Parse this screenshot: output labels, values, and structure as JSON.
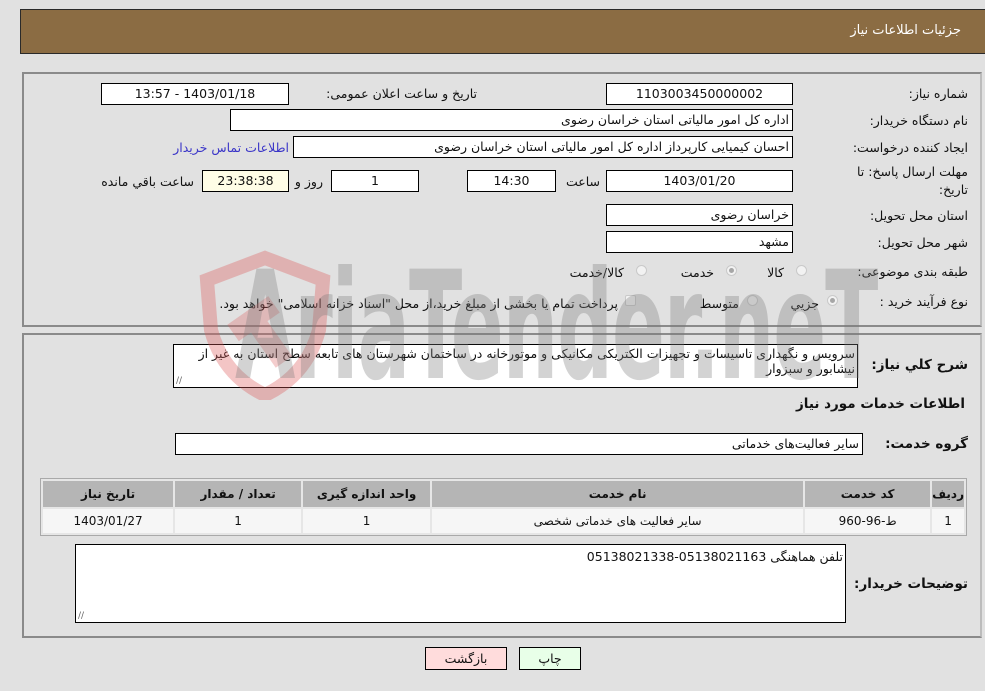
{
  "header": {
    "title": "جزئیات اطلاعات نیاز"
  },
  "details": {
    "need_number": {
      "label": "شماره نیاز:",
      "value": "1103003450000002"
    },
    "announce_datetime": {
      "label": "تاریخ و ساعت اعلان عمومی:",
      "value": "1403/01/18 - 13:57"
    },
    "buyer_org": {
      "label": "نام دستگاه خریدار:",
      "value": "اداره کل امور مالیاتی استان خراسان رضوی"
    },
    "requester": {
      "label": "ایجاد کننده درخواست:",
      "value": "احسان کیمیایی کارپرداز اداره کل امور مالیاتی استان خراسان رضوی"
    },
    "buyer_contact_link": "اطلاعات تماس خریدار",
    "deadline": {
      "label_line1": "مهلت ارسال پاسخ: تا",
      "label_line2": "تاریخ:",
      "date": "1403/01/20",
      "time_label": "ساعت",
      "time": "14:30",
      "days": "1",
      "days_label": "روز و",
      "remaining": "23:38:38",
      "remaining_label": "ساعت باقي مانده"
    },
    "province": {
      "label": "استان محل تحویل:",
      "value": "خراسان رضوی"
    },
    "city": {
      "label": "شهر محل تحویل:",
      "value": "مشهد"
    },
    "category": {
      "label": "طبقه بندی موضوعی:",
      "options": [
        {
          "label": "کالا",
          "checked": false
        },
        {
          "label": "خدمت",
          "checked": true
        },
        {
          "label": "کالا/خدمت",
          "checked": false
        }
      ]
    },
    "process": {
      "label": "نوع فرآیند خرید :",
      "options": [
        {
          "label": "جزيي",
          "checked": true
        },
        {
          "label": "متوسط",
          "checked": false
        }
      ],
      "treasury": {
        "label": "پرداخت تمام یا بخشی از مبلغ خرید،از محل \"اسناد خزانه اسلامی\" خواهد بود.",
        "checked": false
      }
    }
  },
  "services": {
    "description_label": "شرح کلي نیاز:",
    "description": "سرویس و نگهداری تاسیسات و تجهیزات الکتریکی مکانیکی و موتورخانه در ساختمان شهرستان های تابعه سطح استان به غیر از نیشابور و سبزوار",
    "section_title": "اطلاعات خدمات مورد نیاز",
    "group_label": "گروه خدمت:",
    "group_value": "سایر فعالیت‌های خدماتی",
    "table": {
      "columns": [
        "ردیف",
        "کد خدمت",
        "نام خدمت",
        "واحد اندازه گیری",
        "تعداد / مقدار",
        "تاریخ نیاز"
      ],
      "rows": [
        {
          "row_no": "1",
          "code": "ط-96-960",
          "name": "سایر فعالیت های خدماتی شخصی",
          "unit": "1",
          "quantity": "1",
          "need_date": "1403/01/27"
        }
      ]
    },
    "buyer_notes_label": "توضیحات خریدار:",
    "buyer_notes": "تلفن هماهنگی 05138021163-05138021338"
  },
  "buttons": {
    "back": "بازگشت",
    "print": "چاپ"
  },
  "watermark": {
    "text": "AriaTender.neT"
  }
}
